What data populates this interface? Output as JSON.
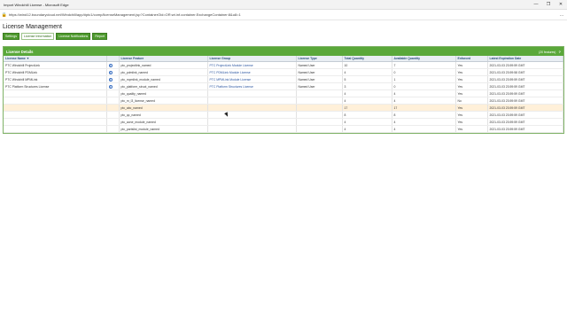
{
  "window": {
    "title": "Import Windchill License - Microsoft Edge",
    "minimize": "—",
    "restore": "❐",
    "close": "✕"
  },
  "address": {
    "url": "https://wind12.boundarycloud.net/Windchill/app/#ptc1/comp/licenseManagement.jsp?ContainerOid=OR:wt.inf.container.ExchangeContainer:8&u8=1",
    "more": "…"
  },
  "page": {
    "title": "License Management",
    "tabs": [
      "Settings",
      "License Information",
      "License Notifications",
      "Report"
    ],
    "active_tab": 1
  },
  "panel": {
    "title": "License Details",
    "count": "(20 features)",
    "help": "?"
  },
  "table": {
    "columns": [
      "License Name ▼",
      "",
      "License Feature",
      "License Group",
      "License Type",
      "Total Quantity",
      "Available Quantity",
      "Enforced",
      "Latest Expiration Date"
    ],
    "rows": [
      {
        "name": "PTC Windchill ProjectLink",
        "info": true,
        "feature": "ptc_projectlink_named",
        "group": "PTC ProjectLink Module License",
        "type": "Named User",
        "total": "10",
        "avail": "7",
        "enforced": "Yes",
        "exp": "2021-03-03 23:59:59 GMT",
        "hl": false
      },
      {
        "name": "PTC Windchill PDMLink",
        "info": true,
        "feature": "ptc_pdmlink_named",
        "group": "PTC PDMLink Module License",
        "type": "Named User",
        "total": "4",
        "avail": "0",
        "enforced": "Yes",
        "exp": "2021-03-03 23:59:58 GMT",
        "hl": false
      },
      {
        "name": "PTC Windchill MPMLink",
        "info": true,
        "feature": "ptc_mpmlink_module_named",
        "group": "PTC MPMLink Module License",
        "type": "Named User",
        "total": "5",
        "avail": "1",
        "enforced": "Yes",
        "exp": "2021-03-03 23:59:59 GMT",
        "hl": false
      },
      {
        "name": "PTC Platform Structures License",
        "info": true,
        "feature": "ptc_platform_struct_named",
        "group": "PTC Platform Structures License",
        "type": "Named User",
        "total": "3",
        "avail": "0",
        "enforced": "Yes",
        "exp": "2021-03-03 23:59:59 GMT",
        "hl": false
      },
      {
        "name": "",
        "info": false,
        "feature": "ptc_quality_named",
        "group": "",
        "type": "",
        "total": "4",
        "avail": "4",
        "enforced": "Yes",
        "exp": "2021-03-03 23:59:59 GMT",
        "hl": false
      },
      {
        "name": "",
        "info": false,
        "feature": "ptc_m_l3_license_named",
        "group": "",
        "type": "",
        "total": "4",
        "avail": "4",
        "enforced": "No",
        "exp": "2021-03-03 23:59:59 GMT",
        "hl": false
      },
      {
        "name": "",
        "info": false,
        "feature": "ptc_abc_named",
        "group": "",
        "type": "",
        "total": "17",
        "avail": "17",
        "enforced": "Yes",
        "exp": "2021-03-03 23:59:59 GMT",
        "hl": true
      },
      {
        "name": "",
        "info": false,
        "feature": "ptc_qc_named",
        "group": "",
        "type": "",
        "total": "8",
        "avail": "8",
        "enforced": "Yes",
        "exp": "2021-03-03 23:59:59 GMT",
        "hl": false
      },
      {
        "name": "",
        "info": false,
        "feature": "ptc_aone_module_named",
        "group": "",
        "type": "",
        "total": "4",
        "avail": "4",
        "enforced": "Yes",
        "exp": "2021-03-03 23:59:59 GMT",
        "hl": false
      },
      {
        "name": "",
        "info": false,
        "feature": "ptc_partslist_module_named",
        "group": "",
        "type": "",
        "total": "4",
        "avail": "4",
        "enforced": "Yes",
        "exp": "2021-03-03 23:59:59 GMT",
        "hl": false
      }
    ]
  }
}
